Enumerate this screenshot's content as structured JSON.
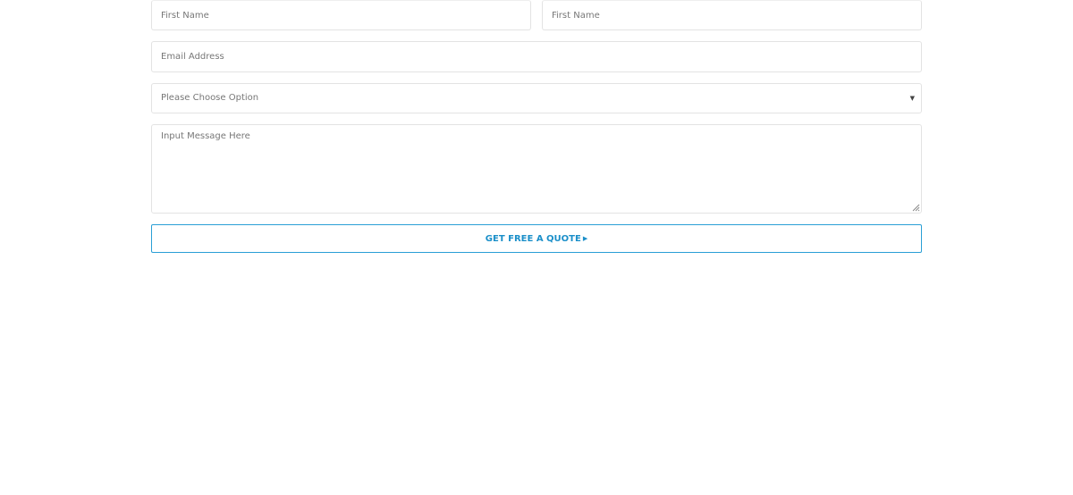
{
  "form": {
    "first_name_placeholder": "First Name",
    "second_name_placeholder": "First Name",
    "email_placeholder": "Email Address",
    "select_value": "Please Choose Option",
    "select_caret_icon": "triangle-down",
    "message_placeholder": "Input Message Here",
    "submit_label": "GET FREE A QUOTE",
    "submit_icon": "caret-right",
    "colors": {
      "accent": "#1b8fc9",
      "border": "#e3e3e3",
      "placeholder": "#777777"
    }
  }
}
